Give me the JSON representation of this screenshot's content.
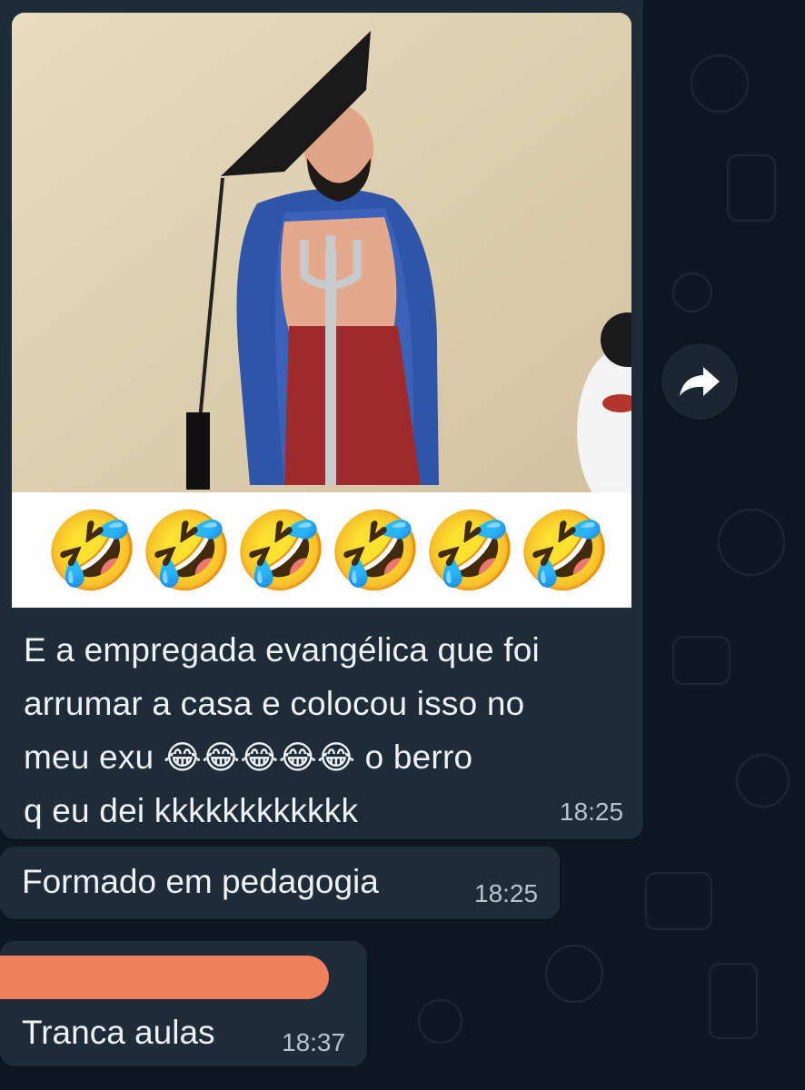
{
  "message_media": {
    "emoji_row": [
      "🤣",
      "🤣",
      "🤣",
      "🤣",
      "🤣",
      "🤣"
    ]
  },
  "message_text": {
    "line1": "E a empregada evangélica que foi",
    "line2": "arrumar a casa e colocou isso no",
    "line3_prefix": "meu exu",
    "line3_emojis": "😂😂😂😂😂",
    "line3_suffix": "o berro",
    "line4": "q eu dei kkkkkkkkkkkk",
    "time": "18:25"
  },
  "message_2": {
    "text": "Formado em pedagogia",
    "time": "18:25"
  },
  "message_3": {
    "text": "Tranca aulas",
    "time": "18:37"
  },
  "share_icon": "forward-arrow-icon"
}
